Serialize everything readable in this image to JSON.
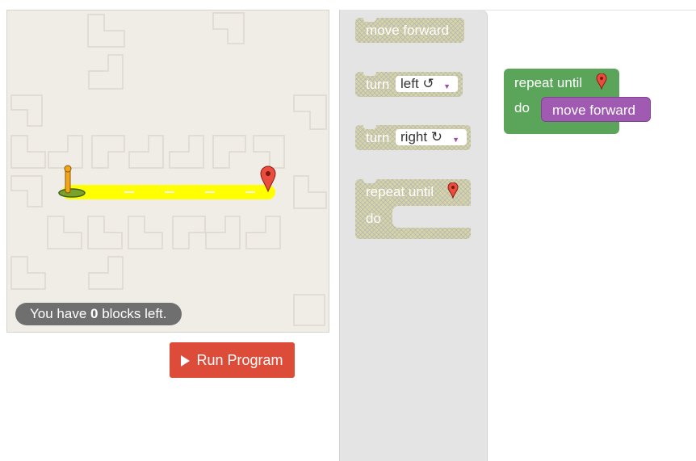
{
  "maze": {
    "blocks_left_prefix": "You have ",
    "blocks_left_count": "0",
    "blocks_left_suffix": " blocks left."
  },
  "run_button": {
    "label": "Run Program"
  },
  "toolbox": {
    "move_forward": "move forward",
    "turn_label": "turn",
    "turn_left_value": "left ↺",
    "turn_right_value": "right ↻",
    "repeat_until": "repeat until",
    "do_label": "do"
  },
  "program": {
    "repeat_until": "repeat until",
    "do_label": "do",
    "inner_block": "move forward"
  },
  "colors": {
    "run_button": "#dd4b39",
    "repeat_block": "#5ba55b",
    "move_block": "#a05ab2",
    "path": "#ffff00",
    "toolbox_bg": "#e4e4e4",
    "maze_bg": "#f0ede7"
  }
}
